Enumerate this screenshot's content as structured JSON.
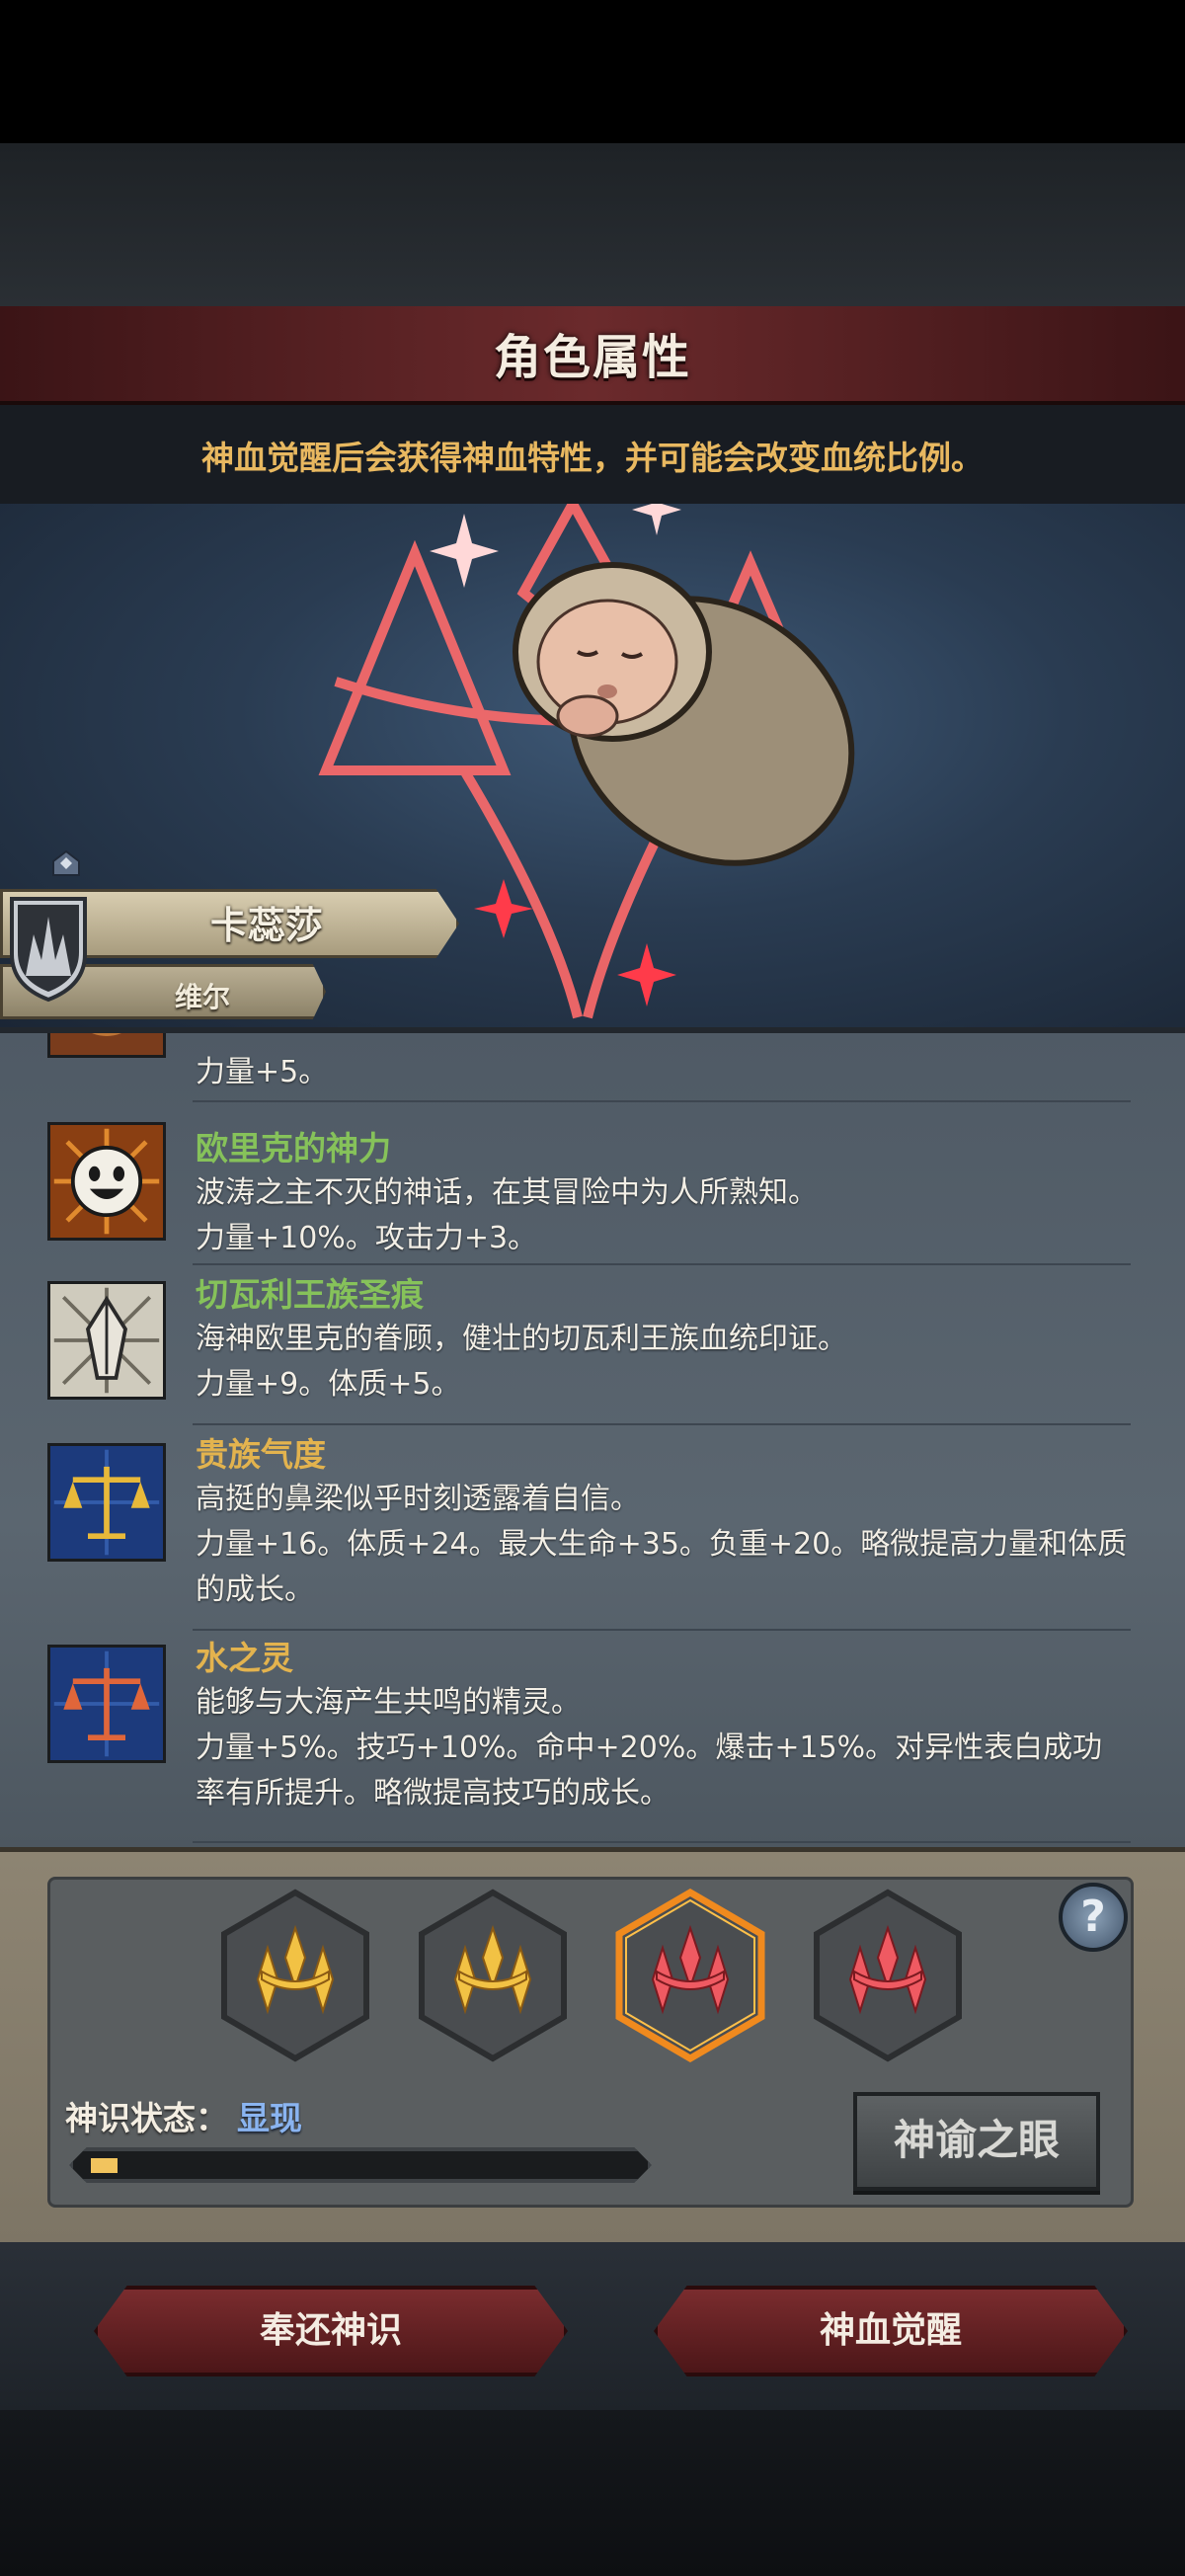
{
  "header": {
    "title": "角色属性"
  },
  "hint": {
    "text": "神血觉醒后会获得神血特性，并可能会改变血统比例。"
  },
  "character": {
    "name": "卡蕊莎",
    "origin": "维尔"
  },
  "traits": [
    {
      "title": "",
      "lines": [
        "力量+5。"
      ]
    },
    {
      "title": "欧里克的神力",
      "title_color": "#86c25a",
      "lines": [
        "波涛之主不灭的神话，在其冒险中为人所熟知。",
        "力量+10%。攻击力+3。"
      ]
    },
    {
      "title": "切瓦利王族圣痕",
      "title_color": "#86c25a",
      "lines": [
        "海神欧里克的眷顾，健壮的切瓦利王族血统印证。",
        "力量+9。体质+5。"
      ]
    },
    {
      "title": "贵族气度",
      "title_color": "#e3b34e",
      "lines": [
        "高挺的鼻梁似乎时刻透露着自信。",
        "力量+16。体质+24。最大生命+35。负重+20。略微提高力量和体质",
        "的成长。"
      ]
    },
    {
      "title": "水之灵",
      "title_color": "#e3b34e",
      "lines": [
        "能够与大海产生共鸣的精灵。",
        "力量+5%。技巧+10%。命中+20%。爆击+15%。对异性表白成功",
        "率有所提升。略微提高技巧的成长。"
      ]
    }
  ],
  "awakening": {
    "slots": [
      "gold-crest-icon",
      "gold-crest-icon",
      "red-crest-icon",
      "red-crest-icon"
    ],
    "selected_index": 2,
    "help_label": "?",
    "status_label": "神识状态：",
    "status_value": "显现",
    "progress": 0.05,
    "oracle_button": "神谕之眼"
  },
  "actions": {
    "return_button": "奉还神识",
    "awaken_button": "神血觉醒"
  }
}
